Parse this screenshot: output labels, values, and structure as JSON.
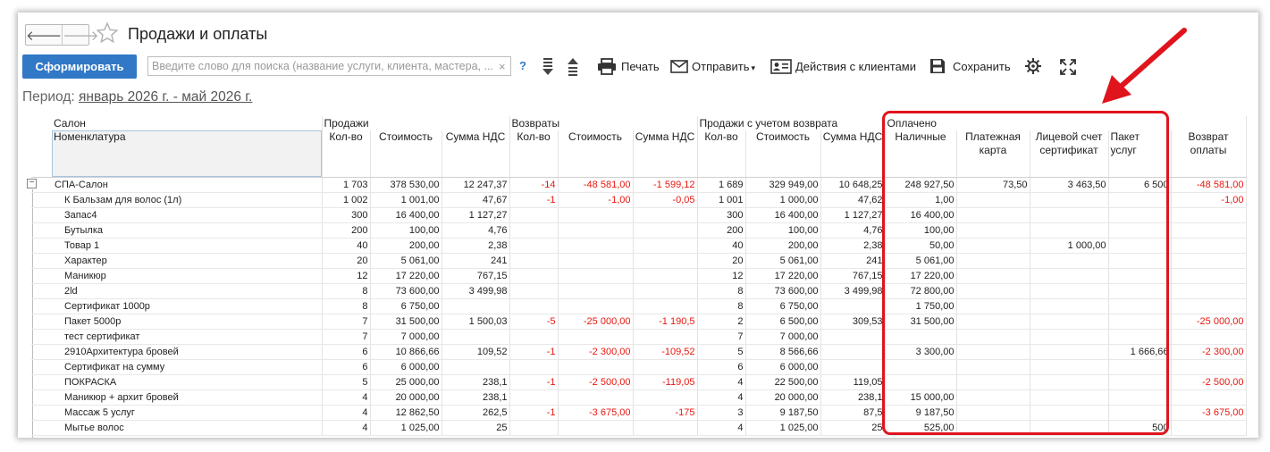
{
  "window": {
    "title": "Продажи и оплаты"
  },
  "toolbar": {
    "generate_label": "Сформировать",
    "search_placeholder": "Введите слово для поиска (название услуги, клиента, мастера, ...",
    "search_value": "",
    "clear_glyph": "×",
    "help_glyph": "?",
    "print_label": "Печать",
    "send_label": "Отправить",
    "send_caret": "▾",
    "client_actions_label": "Действия с клиентами",
    "save_label": "Сохранить"
  },
  "period": {
    "label": "Период:",
    "value": "январь 2026 г. - май 2026 г."
  },
  "table": {
    "group_headers": {
      "salon": "Салон",
      "sales": "Продажи",
      "returns": "Возвраты",
      "sales_net": "Продажи с учетом возврата",
      "paid": "Оплачено"
    },
    "columns": {
      "nomenclature": "Номенклатура",
      "qty": "Кол-во",
      "cost": "Стоимость",
      "vat": "Сумма НДС",
      "cash": "Наличные",
      "card": "Платежная карта",
      "account": "Лицевой счет сертификат",
      "package": "Пакет услуг",
      "refund": "Возврат оплаты"
    },
    "rows": [
      {
        "name": "СПА-Салон",
        "group": true,
        "s_qty": "1 703",
        "s_cost": "378 530,00",
        "s_vat": "12 247,37",
        "r_qty": "-14",
        "r_cost": "-48 581,00",
        "r_vat": "-1 599,12",
        "n_qty": "1 689",
        "n_cost": "329 949,00",
        "n_vat": "10 648,25",
        "cash": "248 927,50",
        "card": "73,50",
        "account": "3 463,50",
        "package": "6 500",
        "refund": "-48 581,00"
      },
      {
        "name": "К Бальзам для волос (1л)",
        "s_qty": "1 002",
        "s_cost": "1 001,00",
        "s_vat": "47,67",
        "r_qty": "-1",
        "r_cost": "-1,00",
        "r_vat": "-0,05",
        "n_qty": "1 001",
        "n_cost": "1 000,00",
        "n_vat": "47,62",
        "cash": "1,00",
        "card": "",
        "account": "",
        "package": "",
        "refund": "-1,00"
      },
      {
        "name": "Запас4",
        "s_qty": "300",
        "s_cost": "16 400,00",
        "s_vat": "1 127,27",
        "r_qty": "",
        "r_cost": "",
        "r_vat": "",
        "n_qty": "300",
        "n_cost": "16 400,00",
        "n_vat": "1 127,27",
        "cash": "16 400,00",
        "card": "",
        "account": "",
        "package": "",
        "refund": ""
      },
      {
        "name": "Бутылка",
        "s_qty": "200",
        "s_cost": "100,00",
        "s_vat": "4,76",
        "r_qty": "",
        "r_cost": "",
        "r_vat": "",
        "n_qty": "200",
        "n_cost": "100,00",
        "n_vat": "4,76",
        "cash": "100,00",
        "card": "",
        "account": "",
        "package": "",
        "refund": ""
      },
      {
        "name": "Товар 1",
        "s_qty": "40",
        "s_cost": "200,00",
        "s_vat": "2,38",
        "r_qty": "",
        "r_cost": "",
        "r_vat": "",
        "n_qty": "40",
        "n_cost": "200,00",
        "n_vat": "2,38",
        "cash": "50,00",
        "card": "",
        "account": "1 000,00",
        "package": "",
        "refund": ""
      },
      {
        "name": "Характер",
        "s_qty": "20",
        "s_cost": "5 061,00",
        "s_vat": "241",
        "r_qty": "",
        "r_cost": "",
        "r_vat": "",
        "n_qty": "20",
        "n_cost": "5 061,00",
        "n_vat": "241",
        "cash": "5 061,00",
        "card": "",
        "account": "",
        "package": "",
        "refund": ""
      },
      {
        "name": "Маникюр",
        "s_qty": "12",
        "s_cost": "17 220,00",
        "s_vat": "767,15",
        "r_qty": "",
        "r_cost": "",
        "r_vat": "",
        "n_qty": "12",
        "n_cost": "17 220,00",
        "n_vat": "767,15",
        "cash": "17 220,00",
        "card": "",
        "account": "",
        "package": "",
        "refund": ""
      },
      {
        "name": "2ld",
        "s_qty": "8",
        "s_cost": "73 600,00",
        "s_vat": "3 499,98",
        "r_qty": "",
        "r_cost": "",
        "r_vat": "",
        "n_qty": "8",
        "n_cost": "73 600,00",
        "n_vat": "3 499,98",
        "cash": "72 800,00",
        "card": "",
        "account": "",
        "package": "",
        "refund": ""
      },
      {
        "name": "Сертификат 1000р",
        "s_qty": "8",
        "s_cost": "6 750,00",
        "s_vat": "",
        "r_qty": "",
        "r_cost": "",
        "r_vat": "",
        "n_qty": "8",
        "n_cost": "6 750,00",
        "n_vat": "",
        "cash": "1 750,00",
        "card": "",
        "account": "",
        "package": "",
        "refund": ""
      },
      {
        "name": "Пакет 5000р",
        "s_qty": "7",
        "s_cost": "31 500,00",
        "s_vat": "1 500,03",
        "r_qty": "-5",
        "r_cost": "-25 000,00",
        "r_vat": "-1 190,5",
        "n_qty": "2",
        "n_cost": "6 500,00",
        "n_vat": "309,53",
        "cash": "31 500,00",
        "card": "",
        "account": "",
        "package": "",
        "refund": "-25 000,00"
      },
      {
        "name": "тест сертификат",
        "s_qty": "7",
        "s_cost": "7 000,00",
        "s_vat": "",
        "r_qty": "",
        "r_cost": "",
        "r_vat": "",
        "n_qty": "7",
        "n_cost": "7 000,00",
        "n_vat": "",
        "cash": "",
        "card": "",
        "account": "",
        "package": "",
        "refund": ""
      },
      {
        "name": "2910Архитектура бровей",
        "s_qty": "6",
        "s_cost": "10 866,66",
        "s_vat": "109,52",
        "r_qty": "-1",
        "r_cost": "-2 300,00",
        "r_vat": "-109,52",
        "n_qty": "5",
        "n_cost": "8 566,66",
        "n_vat": "",
        "cash": "3 300,00",
        "card": "",
        "account": "",
        "package": "1 666,66",
        "refund": "-2 300,00"
      },
      {
        "name": "Сертификат на сумму",
        "s_qty": "6",
        "s_cost": "6 000,00",
        "s_vat": "",
        "r_qty": "",
        "r_cost": "",
        "r_vat": "",
        "n_qty": "6",
        "n_cost": "6 000,00",
        "n_vat": "",
        "cash": "",
        "card": "",
        "account": "",
        "package": "",
        "refund": ""
      },
      {
        "name": "ПОКРАСКА",
        "s_qty": "5",
        "s_cost": "25 000,00",
        "s_vat": "238,1",
        "r_qty": "-1",
        "r_cost": "-2 500,00",
        "r_vat": "-119,05",
        "n_qty": "4",
        "n_cost": "22 500,00",
        "n_vat": "119,05",
        "cash": "",
        "card": "",
        "account": "",
        "package": "",
        "refund": "-2 500,00"
      },
      {
        "name": "Маникюр + архит бровей",
        "s_qty": "4",
        "s_cost": "20 000,00",
        "s_vat": "238,1",
        "r_qty": "",
        "r_cost": "",
        "r_vat": "",
        "n_qty": "4",
        "n_cost": "20 000,00",
        "n_vat": "238,1",
        "cash": "15 000,00",
        "card": "",
        "account": "",
        "package": "",
        "refund": ""
      },
      {
        "name": "Массаж 5 услуг",
        "s_qty": "4",
        "s_cost": "12 862,50",
        "s_vat": "262,5",
        "r_qty": "-1",
        "r_cost": "-3 675,00",
        "r_vat": "-175",
        "n_qty": "3",
        "n_cost": "9 187,50",
        "n_vat": "87,5",
        "cash": "9 187,50",
        "card": "",
        "account": "",
        "package": "",
        "refund": "-3 675,00"
      },
      {
        "name": "Мытье волос",
        "s_qty": "4",
        "s_cost": "1 025,00",
        "s_vat": "25",
        "r_qty": "",
        "r_cost": "",
        "r_vat": "",
        "n_qty": "4",
        "n_cost": "1 025,00",
        "n_vat": "25",
        "cash": "525,00",
        "card": "",
        "account": "",
        "package": "500",
        "refund": ""
      }
    ]
  },
  "icons": {
    "back": "back-arrow-icon",
    "forward": "forward-arrow-icon",
    "favorite": "star-icon",
    "expand_all": "expand-all-icon",
    "collapse_all": "collapse-all-icon",
    "print": "printer-icon",
    "send": "envelope-icon",
    "clients": "contact-card-icon",
    "save": "floppy-disk-icon",
    "settings": "gear-icon",
    "fullscreen": "fullscreen-icon",
    "tree_toggle": "minus-box-icon"
  },
  "colors": {
    "primary_button": "#3178c6",
    "negative_value": "#e8170f",
    "annotation": "#e0141d"
  }
}
